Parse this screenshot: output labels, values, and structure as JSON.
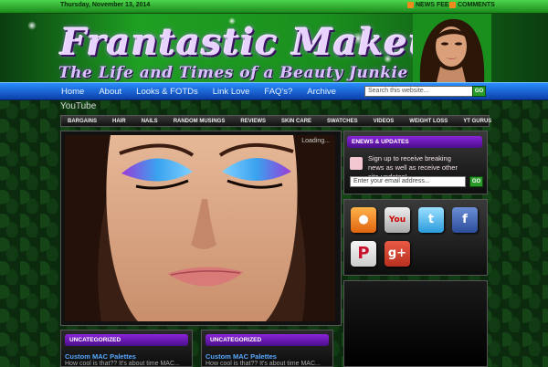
{
  "topbar": {
    "date": "Thursday, November 13, 2014",
    "news_feed": "NEWS FEED",
    "comments": "COMMENTS"
  },
  "header": {
    "title": "Frantastic Makeup",
    "tagline": "The Life and Times of a Beauty Junkie"
  },
  "nav": {
    "items": [
      "Home",
      "About",
      "Looks & FOTDs",
      "Link Love",
      "FAQ's?",
      "Archive"
    ]
  },
  "search": {
    "placeholder": "Search this website...",
    "button": "GO"
  },
  "section_label": "YouTube",
  "categories": [
    "BARGAINS",
    "HAIR",
    "NAILS",
    "RANDOM MUSINGS",
    "REVIEWS",
    "SKIN CARE",
    "SWATCHES",
    "VIDEOS",
    "WEIGHT LOSS",
    "YT GURUS"
  ],
  "featured": {
    "loading": "Loading..."
  },
  "sidebar": {
    "enews_heading": "ENEWS & UPDATES",
    "enews_text": "Sign up to receive breaking news as well as receive other site updates!",
    "email_placeholder": "Enter your email address...",
    "email_button": "GO",
    "social": [
      "rss",
      "youtube",
      "twitter",
      "facebook",
      "pinterest",
      "google-plus"
    ]
  },
  "posts": [
    {
      "category": "UNCATEGORIZED",
      "title": "Custom MAC Palettes",
      "excerpt": "How cool is that?? It's about time MAC..."
    },
    {
      "category": "UNCATEGORIZED",
      "title": "Custom MAC Palettes",
      "excerpt": "How cool is that?? It's about time MAC..."
    }
  ],
  "colors": {
    "green": "#1fa022",
    "blue_nav": "#1a5fd6",
    "purple": "#6a1bb3",
    "link": "#56a8ff"
  }
}
